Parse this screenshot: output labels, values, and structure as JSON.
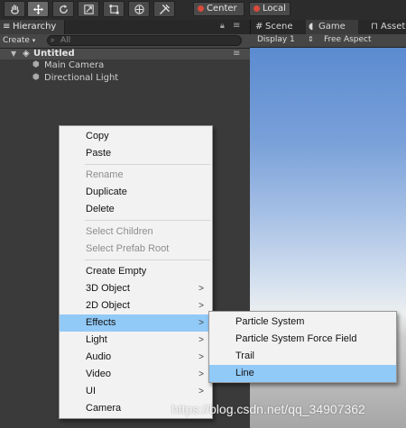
{
  "toolbar": {
    "tools": [
      "hand-tool",
      "move-tool",
      "rotate-tool",
      "scale-tool",
      "rect-tool",
      "transform-tool",
      "custom-tool"
    ],
    "pivot_label": "Center",
    "space_label": "Local"
  },
  "hierarchy": {
    "tab_label": "Hierarchy",
    "create_label": "Create",
    "search_placeholder": "All",
    "scene_name": "Untitled",
    "items": [
      "Main Camera",
      "Directional Light"
    ]
  },
  "game": {
    "tabs": [
      "Scene",
      "Game",
      "Asset"
    ],
    "display_label": "Display 1",
    "aspect_label": "Free Aspect"
  },
  "context_menu": {
    "items": [
      {
        "label": "Copy",
        "enabled": true
      },
      {
        "label": "Paste",
        "enabled": true
      },
      {
        "label": "Rename",
        "enabled": false
      },
      {
        "label": "Duplicate",
        "enabled": true
      },
      {
        "label": "Delete",
        "enabled": true
      },
      {
        "label": "Select Children",
        "enabled": false
      },
      {
        "label": "Select Prefab Root",
        "enabled": false
      },
      {
        "label": "Create Empty",
        "enabled": true
      },
      {
        "label": "3D Object",
        "enabled": true,
        "submenu": true
      },
      {
        "label": "2D Object",
        "enabled": true,
        "submenu": true
      },
      {
        "label": "Effects",
        "enabled": true,
        "submenu": true,
        "highlighted": true
      },
      {
        "label": "Light",
        "enabled": true,
        "submenu": true
      },
      {
        "label": "Audio",
        "enabled": true,
        "submenu": true
      },
      {
        "label": "Video",
        "enabled": true,
        "submenu": true
      },
      {
        "label": "UI",
        "enabled": true,
        "submenu": true
      },
      {
        "label": "Camera",
        "enabled": true
      }
    ]
  },
  "effects_submenu": {
    "items": [
      {
        "label": "Particle System"
      },
      {
        "label": "Particle System Force Field"
      },
      {
        "label": "Trail"
      },
      {
        "label": "Line",
        "highlighted": true
      }
    ]
  },
  "watermark": "https://blog.csdn.net/qq_34907362",
  "colors": {
    "highlight": "#91c9f7",
    "menu_bg": "#f2f2f2",
    "editor_bg": "#3a3a3a",
    "pivot_dot": "#d84a3a",
    "local_dot": "#d84a3a"
  }
}
